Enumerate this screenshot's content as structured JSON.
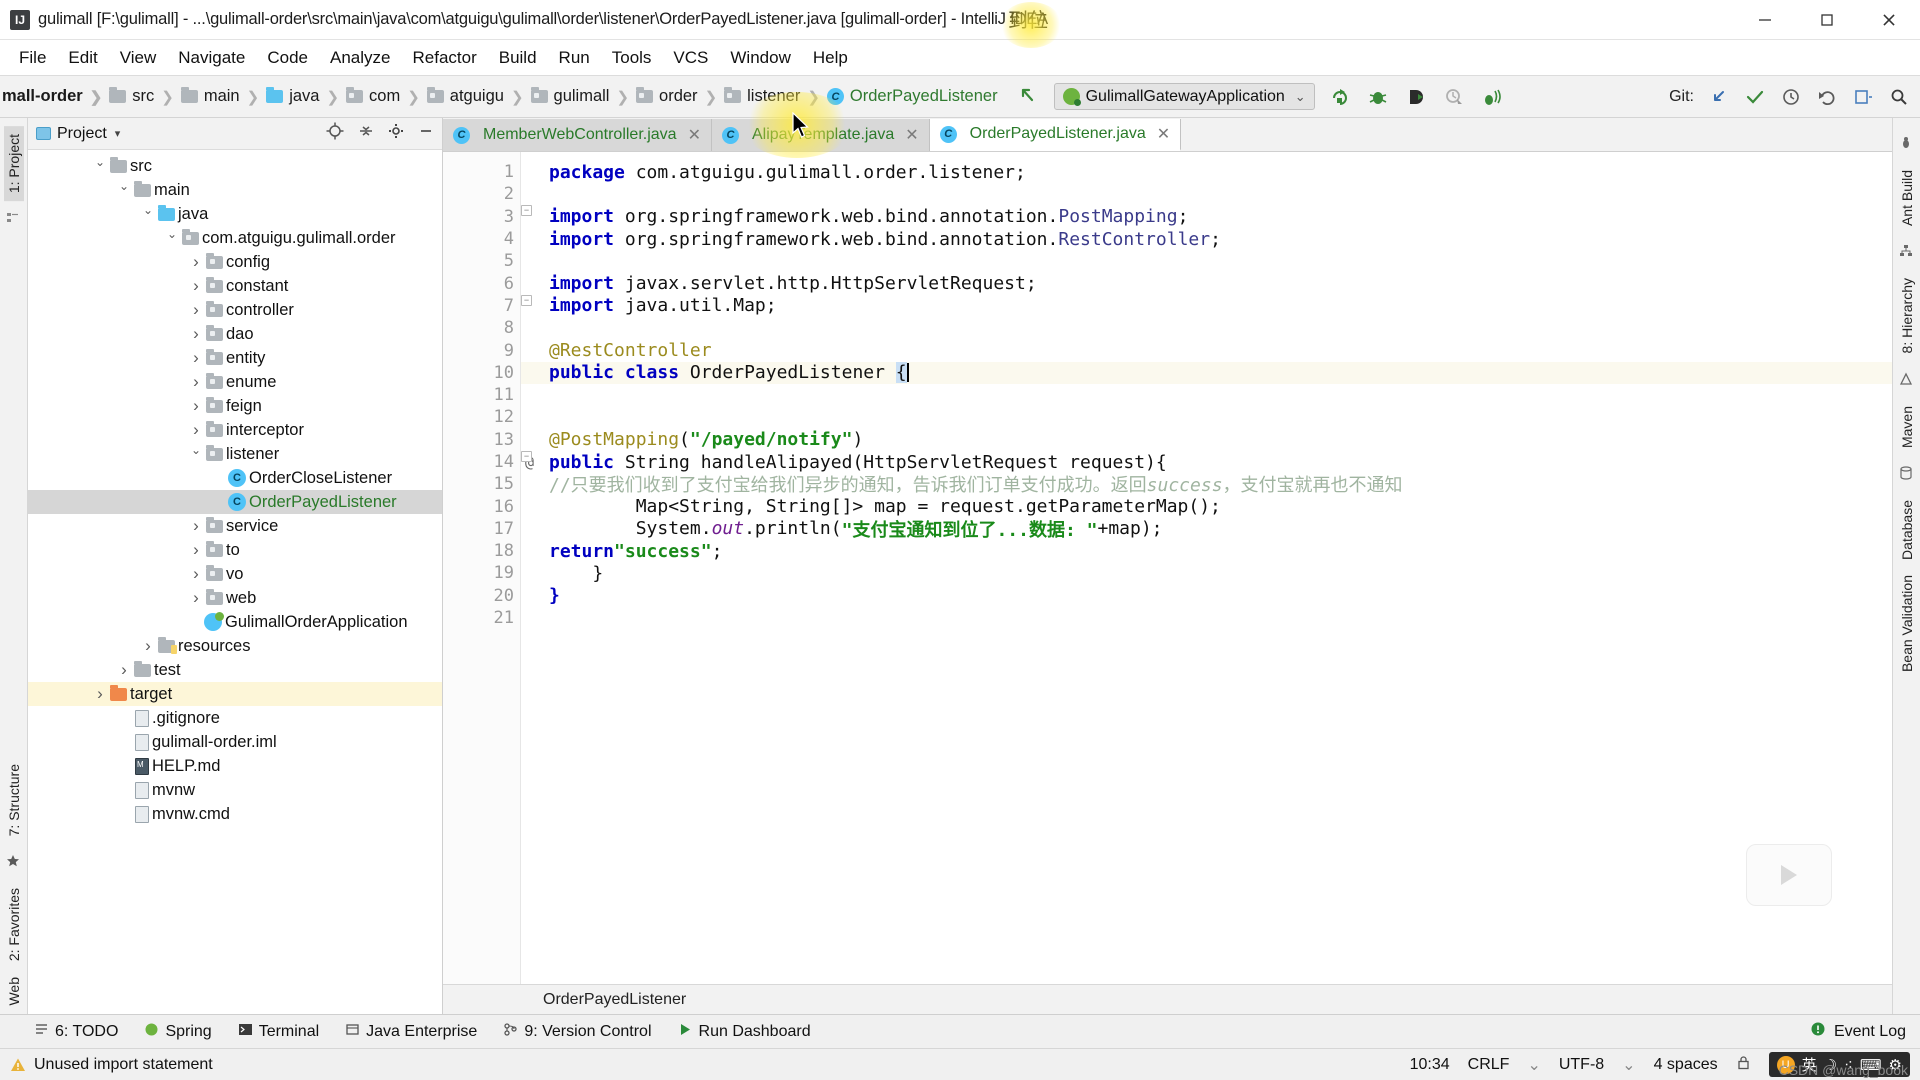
{
  "window": {
    "title": "gulimall [F:\\gulimall] - ...\\gulimall-order\\src\\main\\java\\com\\atguigu\\gulimall\\order\\listener\\OrderPayedListener.java [gulimall-order] - IntelliJ IDEA",
    "app_icon": "intellij-idea-icon",
    "minimize": "—",
    "maximize": "▢",
    "close": "✕",
    "overlay_note": "到位"
  },
  "menubar": {
    "items": [
      "File",
      "Edit",
      "View",
      "Navigate",
      "Code",
      "Analyze",
      "Refactor",
      "Build",
      "Run",
      "Tools",
      "VCS",
      "Window",
      "Help"
    ]
  },
  "navbar": {
    "breadcrumbs": [
      {
        "label": "mall-order",
        "icon": "module-icon",
        "bold": true
      },
      {
        "label": "src",
        "icon": "folder-icon"
      },
      {
        "label": "main",
        "icon": "folder-icon"
      },
      {
        "label": "java",
        "icon": "source-folder-icon"
      },
      {
        "label": "com",
        "icon": "package-icon"
      },
      {
        "label": "atguigu",
        "icon": "package-icon"
      },
      {
        "label": "gulimall",
        "icon": "package-icon"
      },
      {
        "label": "order",
        "icon": "package-icon"
      },
      {
        "label": "listener",
        "icon": "package-icon"
      },
      {
        "label": "OrderPayedListener",
        "icon": "class-icon",
        "green": true
      }
    ],
    "run_config": {
      "label": "GulimallGatewayApplication",
      "icon": "spring-boot-icon",
      "chevron": "⌄"
    },
    "toolbar_icons": [
      "rerun-icon",
      "debug-icon",
      "run-with-coverage-icon",
      "profiler-icon",
      "attach-debugger-icon"
    ],
    "git_label": "Git:",
    "git_icons": [
      "update-project-icon",
      "commit-icon",
      "history-icon",
      "rollback-icon",
      "push-icon",
      "search-everywhere-icon"
    ]
  },
  "left_strip": {
    "tabs": [
      "1: Project",
      "2: Favorites"
    ],
    "bottom_tabs": [
      "7: Structure",
      "Web"
    ]
  },
  "right_strip": {
    "tabs": [
      "Ant Build",
      "8: Hierarchy",
      "Maven",
      "Database",
      "Bean Validation"
    ]
  },
  "project_panel": {
    "title": "Project",
    "caret": "▾",
    "actions": [
      "locate-icon",
      "collapse-all-icon",
      "settings-gear-icon",
      "hide-icon"
    ],
    "tree": [
      {
        "label": "src",
        "depth": 2,
        "arrow": "down",
        "icon": "folder-icon"
      },
      {
        "label": "main",
        "depth": 3,
        "arrow": "down",
        "icon": "folder-icon"
      },
      {
        "label": "java",
        "depth": 4,
        "arrow": "down",
        "icon": "source-folder-icon"
      },
      {
        "label": "com.atguigu.gulimall.order",
        "depth": 5,
        "arrow": "down",
        "icon": "package-icon"
      },
      {
        "label": "config",
        "depth": 6,
        "arrow": "right",
        "icon": "package-icon"
      },
      {
        "label": "constant",
        "depth": 6,
        "arrow": "right",
        "icon": "package-icon"
      },
      {
        "label": "controller",
        "depth": 6,
        "arrow": "right",
        "icon": "package-icon"
      },
      {
        "label": "dao",
        "depth": 6,
        "arrow": "right",
        "icon": "package-icon"
      },
      {
        "label": "entity",
        "depth": 6,
        "arrow": "right",
        "icon": "package-icon"
      },
      {
        "label": "enume",
        "depth": 6,
        "arrow": "right",
        "icon": "package-icon"
      },
      {
        "label": "feign",
        "depth": 6,
        "arrow": "right",
        "icon": "package-icon"
      },
      {
        "label": "interceptor",
        "depth": 6,
        "arrow": "right",
        "icon": "package-icon"
      },
      {
        "label": "listener",
        "depth": 6,
        "arrow": "down",
        "icon": "package-icon"
      },
      {
        "label": "OrderCloseListener",
        "depth": 7,
        "arrow": "none",
        "icon": "class-icon"
      },
      {
        "label": "OrderPayedListener",
        "depth": 7,
        "arrow": "none",
        "icon": "class-icon",
        "selected": true,
        "green": true
      },
      {
        "label": "service",
        "depth": 6,
        "arrow": "right",
        "icon": "package-icon"
      },
      {
        "label": "to",
        "depth": 6,
        "arrow": "right",
        "icon": "package-icon"
      },
      {
        "label": "vo",
        "depth": 6,
        "arrow": "right",
        "icon": "package-icon"
      },
      {
        "label": "web",
        "depth": 6,
        "arrow": "right",
        "icon": "package-icon"
      },
      {
        "label": "GulimallOrderApplication",
        "depth": 6,
        "arrow": "none",
        "icon": "spring-class-icon"
      },
      {
        "label": "resources",
        "depth": 4,
        "arrow": "right",
        "icon": "resources-folder-icon"
      },
      {
        "label": "test",
        "depth": 3,
        "arrow": "right",
        "icon": "folder-icon"
      },
      {
        "label": "target",
        "depth": 2,
        "arrow": "right",
        "icon": "excluded-folder-icon",
        "highlighted": true
      },
      {
        "label": ".gitignore",
        "depth": 3,
        "arrow": "none",
        "icon": "file-icon"
      },
      {
        "label": "gulimall-order.iml",
        "depth": 3,
        "arrow": "none",
        "icon": "file-icon"
      },
      {
        "label": "HELP.md",
        "depth": 3,
        "arrow": "none",
        "icon": "markdown-file-icon"
      },
      {
        "label": "mvnw",
        "depth": 3,
        "arrow": "none",
        "icon": "file-icon"
      },
      {
        "label": "mvnw.cmd",
        "depth": 3,
        "arrow": "none",
        "icon": "file-icon"
      }
    ]
  },
  "editor": {
    "tabs": [
      {
        "label": "MemberWebController.java",
        "icon": "class-icon",
        "active": false
      },
      {
        "label": "AlipayTemplate.java",
        "icon": "class-icon",
        "active": false
      },
      {
        "label": "OrderPayedListener.java",
        "icon": "class-icon",
        "active": true
      }
    ],
    "breadcrumb_status": "OrderPayedListener",
    "line_numbers": [
      "1",
      "2",
      "3",
      "4",
      "5",
      "6",
      "7",
      "8",
      "9",
      "10",
      "11",
      "12",
      "13",
      "14",
      "15",
      "16",
      "17",
      "18",
      "19",
      "20",
      "21"
    ],
    "code_lines": [
      {
        "n": 1,
        "text": "package com.atguigu.gulimall.order.listener;"
      },
      {
        "n": 2,
        "text": ""
      },
      {
        "n": 3,
        "text": "import org.springframework.web.bind.annotation.PostMapping;"
      },
      {
        "n": 4,
        "text": "import org.springframework.web.bind.annotation.RestController;"
      },
      {
        "n": 5,
        "text": ""
      },
      {
        "n": 6,
        "text": "import javax.servlet.http.HttpServletRequest;"
      },
      {
        "n": 7,
        "text": "import java.util.Map;"
      },
      {
        "n": 8,
        "text": ""
      },
      {
        "n": 9,
        "text": "@RestController"
      },
      {
        "n": 10,
        "text": "public class OrderPayedListener {"
      },
      {
        "n": 11,
        "text": ""
      },
      {
        "n": 12,
        "text": ""
      },
      {
        "n": 13,
        "text": "    @PostMapping(\"/payed/notify\")"
      },
      {
        "n": 14,
        "text": "    public String handleAlipayed(HttpServletRequest request){"
      },
      {
        "n": 15,
        "text": "        //只要我们收到了支付宝给我们异步的通知, 告诉我们订单支付成功。返回success, 支付宝就再也不通知"
      },
      {
        "n": 16,
        "text": "        Map<String, String[]> map = request.getParameterMap();"
      },
      {
        "n": 17,
        "text": "        System.out.println(\"支付宝通知到位了...数据: \"+map);"
      },
      {
        "n": 18,
        "text": "        return \"success\";"
      },
      {
        "n": 19,
        "text": "    }"
      },
      {
        "n": 20,
        "text": "}"
      },
      {
        "n": 21,
        "text": ""
      }
    ]
  },
  "bottom_toolwindows": [
    {
      "label": "6: TODO",
      "icon": "todo-icon"
    },
    {
      "label": "Spring",
      "icon": "spring-icon"
    },
    {
      "label": "Terminal",
      "icon": "terminal-icon"
    },
    {
      "label": "Java Enterprise",
      "icon": "java-enterprise-icon"
    },
    {
      "label": "9: Version Control",
      "icon": "version-control-icon"
    },
    {
      "label": "Run Dashboard",
      "icon": "run-dashboard-icon"
    }
  ],
  "event_log": {
    "label": "Event Log",
    "icon": "event-log-icon"
  },
  "statusbar": {
    "message": "Unused import statement",
    "warning_icon": "warning-icon",
    "caret_position": "10:34",
    "line_separator": "CRLF",
    "encoding": "UTF-8",
    "indent": "4 spaces",
    "ime_lang": "英",
    "lock_icon": "lock-icon",
    "watermark": "CSDN @wang_book"
  },
  "colors": {
    "accent_green": "#2a7a2a",
    "keyword_blue": "#0000c0",
    "string_green": "#1a8a1a",
    "annotation_olive": "#9b8b1e",
    "comment_gray": "#a0b4a0",
    "selection_gray": "#d6d6d6",
    "highlight_yellow": "#fdf6d8",
    "caret_line": "#fbf9ee",
    "folder_blue": "#5bc3ef",
    "class_icon_blue": "#4fc3f7"
  }
}
